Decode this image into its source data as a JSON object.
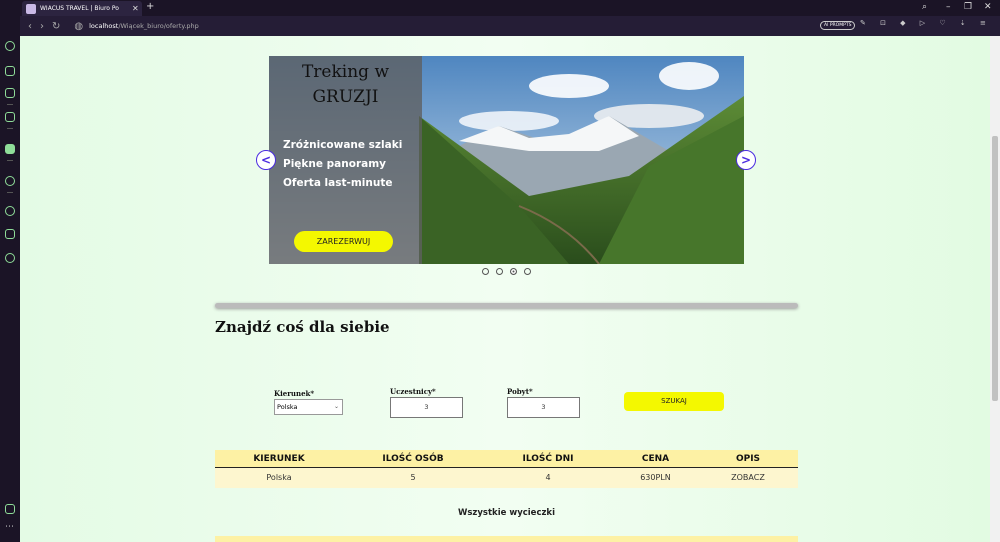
{
  "browser": {
    "tab_title": "WIACUS TRAVEL | Biuro Po",
    "tab_close": "✕",
    "new_tab": "+",
    "url_host": "localhost",
    "url_path": "/Wiącek_biuro/oferty.php",
    "ai_prompts": "AI PROMPTS"
  },
  "hero": {
    "title_line1": "Treking w",
    "title_line2": "GRUZJI",
    "features": [
      "Zróżnicowane szlaki",
      "Piękne panoramy",
      "Oferta last-minute"
    ],
    "reserve_button": "ZAREZERWUJ",
    "prev": "<",
    "next": ">",
    "active_slide": 3,
    "slide_count": 4
  },
  "search": {
    "heading": "Znajdź coś dla siebie",
    "destination_label": "Kierunek*",
    "destination_value": "Polska",
    "participants_label": "Uczestnicy*",
    "participants_value": "3",
    "stay_label": "Pobyt*",
    "stay_value": "3",
    "search_button": "SZUKAJ"
  },
  "results": {
    "headers": [
      "KIERUNEK",
      "ILOŚĆ OSÓB",
      "ILOŚĆ DNI",
      "CENA",
      "OPIS"
    ],
    "rows": [
      {
        "kierunek": "Polska",
        "osoby": "5",
        "dni": "4",
        "cena": "630PLN",
        "opis": "ZOBACZ"
      }
    ],
    "all_trips": "Wszystkie wycieczki"
  },
  "colors": {
    "accent_yellow": "#f4f800",
    "table_header": "#fdf1a4",
    "link": "#7b74e0"
  }
}
